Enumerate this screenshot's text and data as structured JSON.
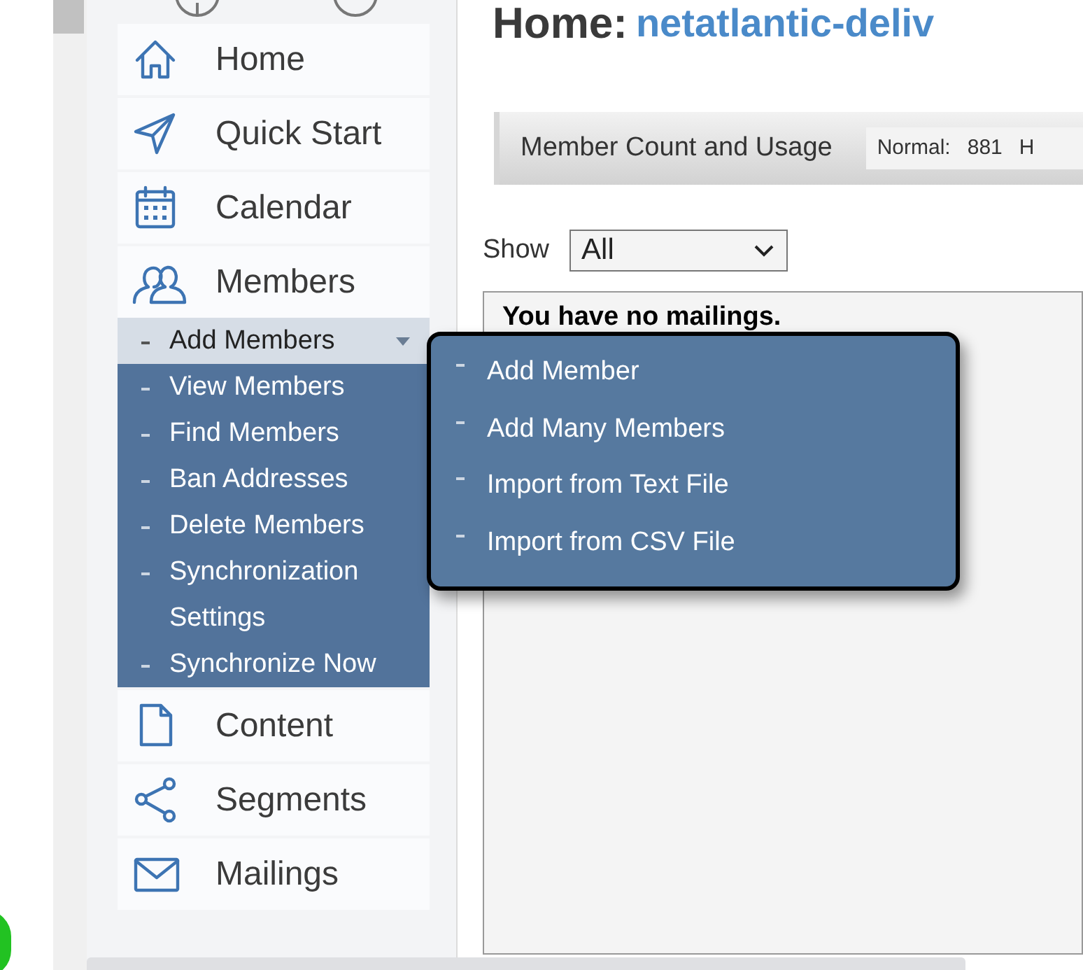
{
  "sidebar": {
    "items": [
      {
        "label": "Home",
        "selected": false
      },
      {
        "label": "Quick Start",
        "selected": false
      },
      {
        "label": "Calendar",
        "selected": false
      },
      {
        "label": "Members",
        "selected": false,
        "expanded": true,
        "children": [
          {
            "label": "Add Members",
            "selected": true,
            "expanded": true,
            "children": [
              {
                "label": "Add Member"
              },
              {
                "label": "Add Many Members"
              },
              {
                "label": "Import from Text File"
              },
              {
                "label": "Import from CSV File"
              }
            ]
          },
          {
            "label": "View Members",
            "selected": false
          },
          {
            "label": "Find Members",
            "selected": false
          },
          {
            "label": "Ban Addresses",
            "selected": false
          },
          {
            "label": "Delete Members",
            "selected": false
          },
          {
            "label": "Synchronization Settings",
            "selected": false
          },
          {
            "label": "Synchronize Now",
            "selected": false
          }
        ]
      },
      {
        "label": "Content",
        "selected": false
      },
      {
        "label": "Segments",
        "selected": false
      },
      {
        "label": "Mailings",
        "selected": false
      }
    ]
  },
  "header": {
    "title": "Home:",
    "list_name": "netatlantic-deliv"
  },
  "usage_bar": {
    "label": "Member Count and Usage",
    "stats": [
      "Normal:",
      "881",
      "H"
    ]
  },
  "filter": {
    "label": "Show",
    "value": "All"
  },
  "mailings": {
    "message": "You have no mailings."
  }
}
